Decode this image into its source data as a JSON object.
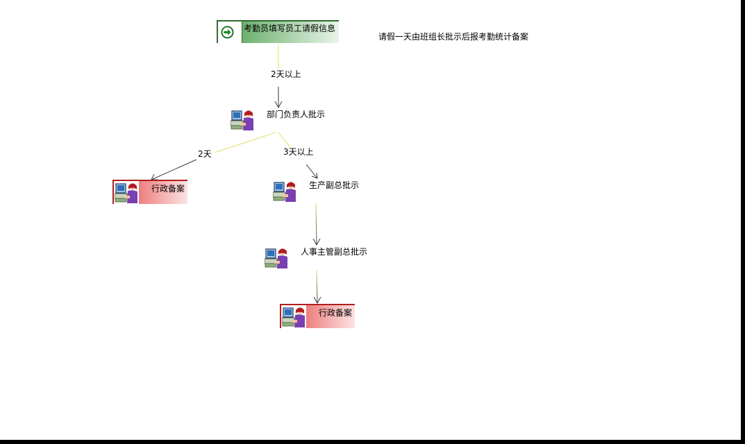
{
  "note": "请假一天由班组长批示后报考勤统计备案",
  "nodes": {
    "start": "考勤员填写员工请假信息",
    "dept_head": "部门负责人批示",
    "admin_file_left": "行政备案",
    "prod_vp": "生产副总批示",
    "hr_vp": "人事主管副总批示",
    "admin_file_bottom": "行政备案"
  },
  "edges": {
    "start_to_dept": "2天以上",
    "dept_to_admin": "2天",
    "dept_to_prod": "3天以上"
  },
  "icons": {
    "start": "go-arrow-icon",
    "person": "person-at-computer-icon"
  },
  "colors": {
    "start_fill": "#4e9a52",
    "end_fill": "#d93a3a",
    "edge_yellow": "#e6e065",
    "edge_dark": "#3a3a3a"
  }
}
